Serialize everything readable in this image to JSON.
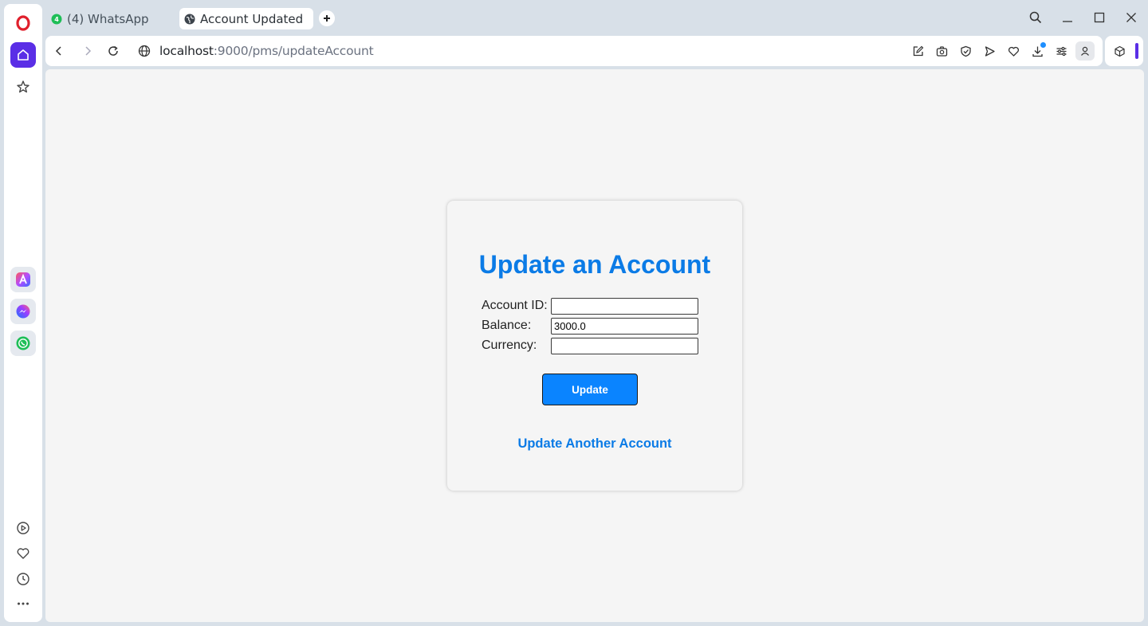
{
  "browser": {
    "tabs": [
      {
        "label": "(4) WhatsApp",
        "active": false,
        "favicon": "whatsapp-icon"
      },
      {
        "label": "Account Updated",
        "active": true,
        "favicon": "globe-icon"
      }
    ],
    "address": {
      "host": "localhost",
      "path": ":9000/pms/updateAccount"
    },
    "accent": "#5a2ee6"
  },
  "page": {
    "title": "Update an Account",
    "form": {
      "account_id": {
        "label": "Account ID:",
        "value": ""
      },
      "balance": {
        "label": "Balance:",
        "value": "3000.0"
      },
      "currency": {
        "label": "Currency:",
        "value": ""
      }
    },
    "submit_label": "Update",
    "link_label": "Update Another Account",
    "accent_color": "#0b7be6",
    "button_color": "#0a84ff"
  }
}
